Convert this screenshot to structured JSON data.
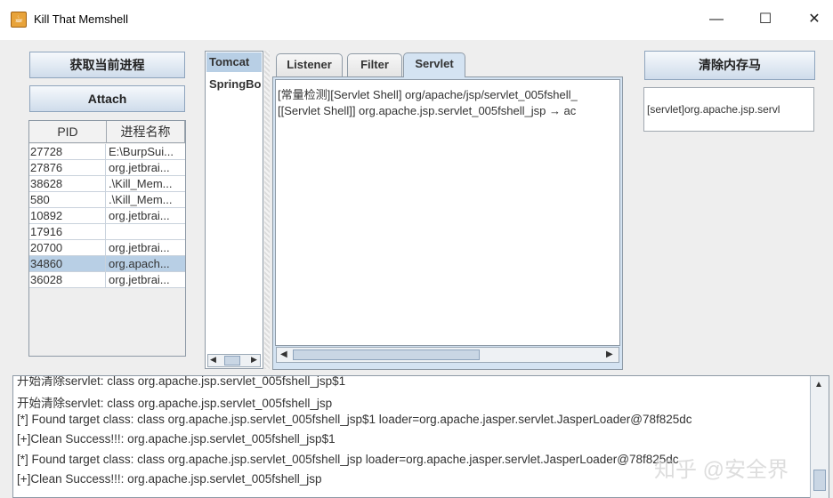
{
  "window": {
    "title": "Kill That Memshell",
    "minimize": "—",
    "maximize": "☐",
    "close": "✕"
  },
  "buttons": {
    "get_processes": "获取当前进程",
    "attach": "Attach",
    "clear_memshell": "清除内存马"
  },
  "process_table": {
    "columns": [
      "PID",
      "进程名称"
    ],
    "rows": [
      {
        "pid": "27728",
        "name": "E:\\BurpSui..."
      },
      {
        "pid": "27876",
        "name": "org.jetbrai..."
      },
      {
        "pid": "38628",
        "name": ".\\Kill_Mem..."
      },
      {
        "pid": "580",
        "name": ".\\Kill_Mem..."
      },
      {
        "pid": "10892",
        "name": "org.jetbrai..."
      },
      {
        "pid": "17916",
        "name": ""
      },
      {
        "pid": "20700",
        "name": "org.jetbrai..."
      },
      {
        "pid": "34860",
        "name": "org.apach..."
      },
      {
        "pid": "36028",
        "name": "org.jetbrai..."
      }
    ],
    "selected_pid": "34860"
  },
  "container_list": {
    "items": [
      "Tomcat",
      "SpringBoot"
    ],
    "selected": "Tomcat"
  },
  "tabs": {
    "items": [
      "Listener",
      "Filter",
      "Servlet"
    ],
    "active": "Servlet"
  },
  "detection_output": [
    "[常量检测][Servlet Shell] org/apache/jsp/servlet_005fshell_",
    "[[Servlet Shell]] org.apache.jsp.servlet_005fshell_jsp → ac"
  ],
  "result_box": "[servlet]org.apache.jsp.servl",
  "log": [
    "开始清除servlet: class org.apache.jsp.servlet_005fshell_jsp$1",
    "开始清除servlet: class org.apache.jsp.servlet_005fshell_jsp",
    "[*] Found target class: class org.apache.jsp.servlet_005fshell_jsp$1 loader=org.apache.jasper.servlet.JasperLoader@78f825dc",
    "[+]Clean Success!!!: org.apache.jsp.servlet_005fshell_jsp$1",
    "[*] Found target class: class org.apache.jsp.servlet_005fshell_jsp loader=org.apache.jasper.servlet.JasperLoader@78f825dc",
    "[+]Clean Success!!!: org.apache.jsp.servlet_005fshell_jsp"
  ],
  "watermark": "知乎 @安全界"
}
